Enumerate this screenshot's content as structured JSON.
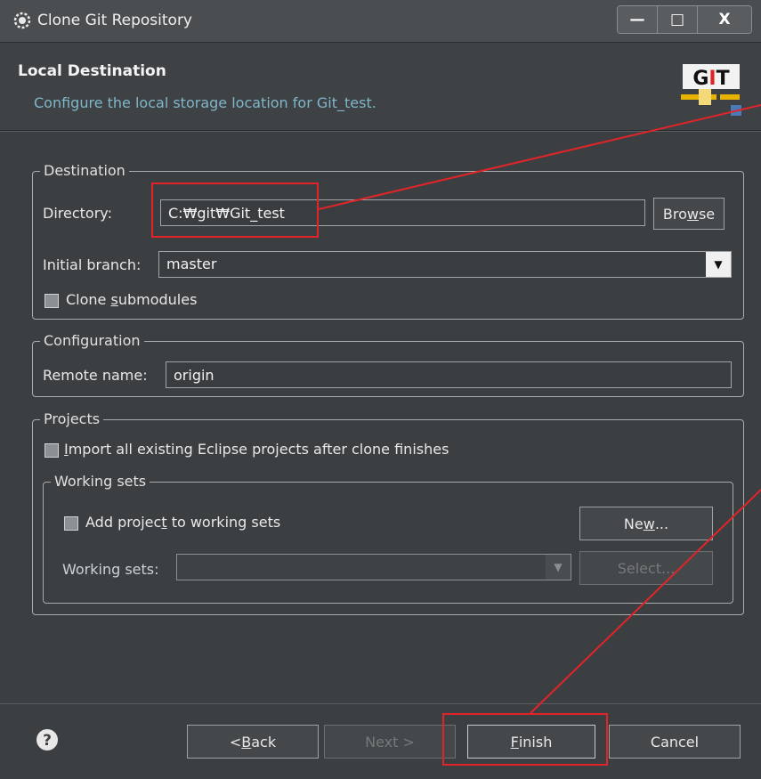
{
  "window": {
    "title": "Clone Git Repository"
  },
  "header": {
    "title": "Local Destination",
    "description": "Configure the local storage location for Git_test.",
    "logo_text": "GIT"
  },
  "destination": {
    "group_label": "Destination",
    "directory_label": "Directory:",
    "directory_value": "C:₩git₩Git_test",
    "browse_prefix": "Bro",
    "browse_mnemonic": "w",
    "browse_suffix": "se",
    "branch_label": "Initial branch:",
    "branch_value": "master",
    "submodules_prefix": "Clone ",
    "submodules_mnemonic": "s",
    "submodules_suffix": "ubmodules"
  },
  "configuration": {
    "group_label": "Configuration",
    "remote_label": "Remote name:",
    "remote_value": "origin"
  },
  "projects": {
    "group_label": "Projects",
    "import_prefix": "",
    "import_mnemonic": "I",
    "import_suffix": "mport all existing Eclipse projects after clone finishes",
    "working_sets_group_label": "Working sets",
    "add_prefix": "Add projec",
    "add_mnemonic": "t",
    "add_suffix": " to working sets",
    "new_prefix": "Ne",
    "new_mnemonic": "w",
    "new_suffix": "...",
    "working_sets_label": "Working sets:",
    "select_label": "Select..."
  },
  "footer": {
    "back_prefix": "< ",
    "back_mnemonic": "B",
    "back_suffix": "ack",
    "next_label": "Next >",
    "finish_mnemonic": "F",
    "finish_suffix": "inish",
    "cancel_label": "Cancel"
  },
  "colors": {
    "background": "#3c3f41",
    "annotation": "#e0242a",
    "link_text": "#7fb6c9"
  }
}
